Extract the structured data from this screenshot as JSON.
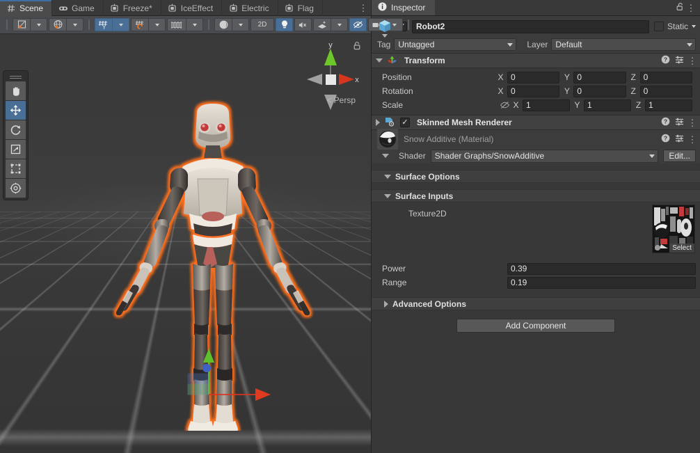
{
  "scene_panel": {
    "tabs": [
      {
        "label": "Scene",
        "icon": "grid-icon",
        "active": true
      },
      {
        "label": "Game",
        "icon": "gamepad-icon",
        "active": false
      },
      {
        "label": "Freeze*",
        "icon": "shader-graph-icon",
        "active": false
      },
      {
        "label": "IceEffect",
        "icon": "shader-graph-icon",
        "active": false
      },
      {
        "label": "Electric",
        "icon": "shader-graph-icon",
        "active": false
      },
      {
        "label": "Flag",
        "icon": "shader-graph-icon",
        "active": false
      }
    ],
    "tab_menu_icon": "kebab-menu-icon",
    "toolbar": {
      "items": [
        {
          "name": "draw-mode-dropdown",
          "icon": "shaded-mode-icon",
          "has_caret": true,
          "active": false
        },
        {
          "name": "scene-2d-lighting-dropdown",
          "icon": "globe-icon",
          "has_caret": true,
          "active": false
        },
        {
          "name": "grid-axis-toggle",
          "icon": "grid-y-icon",
          "label": "",
          "active": true,
          "has_caret": true
        },
        {
          "name": "snap-increment-dropdown",
          "icon": "grid-snap-icon",
          "has_caret": true,
          "active": false
        },
        {
          "name": "grid-size-slider",
          "icon": "ruler-icon",
          "has_caret": true,
          "active": false
        },
        {
          "name": "scene-visibility-dropdown",
          "icon": "shading-sphere-icon",
          "has_caret": true,
          "active": false
        },
        {
          "name": "toggle-2d-button",
          "label": "2D",
          "active": false
        },
        {
          "name": "scene-lighting-toggle",
          "icon": "lightbulb-icon",
          "active": true
        },
        {
          "name": "scene-audio-toggle",
          "icon": "audio-mute-icon",
          "active": false
        },
        {
          "name": "effects-dropdown",
          "icon": "fx-icon",
          "has_caret": true,
          "active": false
        },
        {
          "name": "scene-visibility-toggle",
          "icon": "eye-off-icon",
          "active": true
        },
        {
          "name": "camera-settings-dropdown",
          "icon": "camera-icon",
          "has_caret": true,
          "active": false
        }
      ]
    },
    "tools": [
      {
        "name": "hand-tool",
        "icon": "hand-icon",
        "selected": false
      },
      {
        "name": "move-tool",
        "icon": "move-arrows-icon",
        "selected": true
      },
      {
        "name": "rotate-tool",
        "icon": "rotate-icon",
        "selected": false
      },
      {
        "name": "scale-tool",
        "icon": "scale-icon",
        "selected": false
      },
      {
        "name": "rect-tool",
        "icon": "rect-transform-icon",
        "selected": false
      },
      {
        "name": "transform-tool",
        "icon": "transform-icon",
        "selected": false
      }
    ],
    "gizmo": {
      "x_label": "x",
      "y_label": "y",
      "perspective_label": "Persp",
      "colors": {
        "x": "#d8351f",
        "y": "#6ec729",
        "z": "#9e9e9e"
      }
    },
    "selection_outline_color": "#ff7020"
  },
  "inspector": {
    "tab": {
      "label": "Inspector",
      "icon": "info-icon"
    },
    "lock_icon": "lock-open-icon",
    "menu_icon": "kebab-menu-icon",
    "object": {
      "enabled": true,
      "icon": "prefab-cube-icon",
      "name": "Robot2",
      "static_label": "Static",
      "static_checked": false,
      "tag_label": "Tag",
      "tag_value": "Untagged",
      "layer_label": "Layer",
      "layer_value": "Default"
    },
    "components": [
      {
        "name": "Transform",
        "icon": "transform-axes-icon",
        "expanded": true,
        "help_icon": "help-icon",
        "preset_icon": "preset-icon",
        "menu_icon": "kebab-menu-icon",
        "rows": [
          {
            "label": "Position",
            "x": "0",
            "y": "0",
            "z": "0"
          },
          {
            "label": "Rotation",
            "x": "0",
            "y": "0",
            "z": "0"
          },
          {
            "label": "Scale",
            "x": "1",
            "y": "1",
            "z": "1",
            "link_icon": "constrain-proportions-off-icon"
          }
        ],
        "axis_labels": {
          "x": "X",
          "y": "Y",
          "z": "Z"
        }
      },
      {
        "name": "Skinned Mesh Renderer",
        "icon": "skinned-mesh-renderer-icon",
        "expanded": false,
        "enabled": true,
        "help_icon": "help-icon",
        "preset_icon": "preset-icon",
        "menu_icon": "kebab-menu-icon"
      }
    ],
    "material": {
      "title": "Snow Additive (Material)",
      "thumb_icon": "material-sphere-icon",
      "help_icon": "help-icon",
      "preset_icon": "preset-icon",
      "menu_icon": "kebab-menu-icon",
      "shader_label": "Shader",
      "shader_value": "Shader Graphs/SnowAdditive",
      "edit_button": "Edit...",
      "sections": [
        {
          "name": "Surface Options",
          "expanded": true
        },
        {
          "name": "Surface Inputs",
          "expanded": true
        },
        {
          "name": "Advanced Options",
          "expanded": false
        }
      ],
      "texture_property": {
        "label": "Texture2D",
        "select_label": "Select"
      },
      "properties": [
        {
          "label": "Power",
          "value": "0.39"
        },
        {
          "label": "Range",
          "value": "0.19"
        }
      ]
    },
    "add_component_label": "Add Component"
  }
}
